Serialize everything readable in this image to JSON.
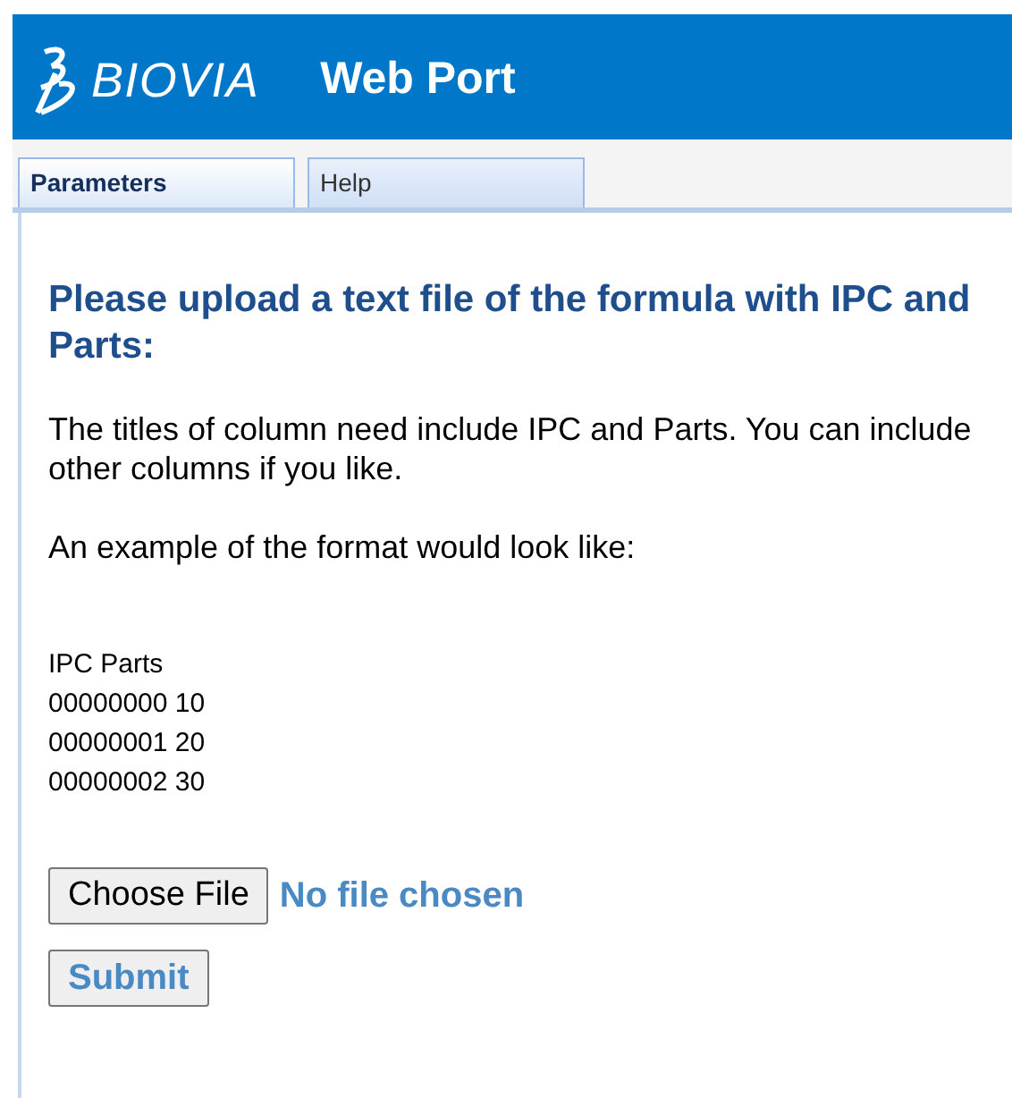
{
  "header": {
    "brand": "BIOVIA",
    "title": "Web Port"
  },
  "tabs": [
    {
      "label": "Parameters",
      "selected": true
    },
    {
      "label": "Help",
      "selected": false
    }
  ],
  "heading": "Please upload a text file of the formula with IPC and Parts:",
  "paragraphs": [
    "The titles of column need include IPC and Parts. You can include other columns if you like.",
    "An example of the format would look like:"
  ],
  "example_lines": [
    "IPC Parts",
    "00000000 10",
    "00000001 20",
    "00000002 30"
  ],
  "file_input": {
    "button": "Choose File",
    "status": "No file chosen"
  },
  "submit": "Submit"
}
